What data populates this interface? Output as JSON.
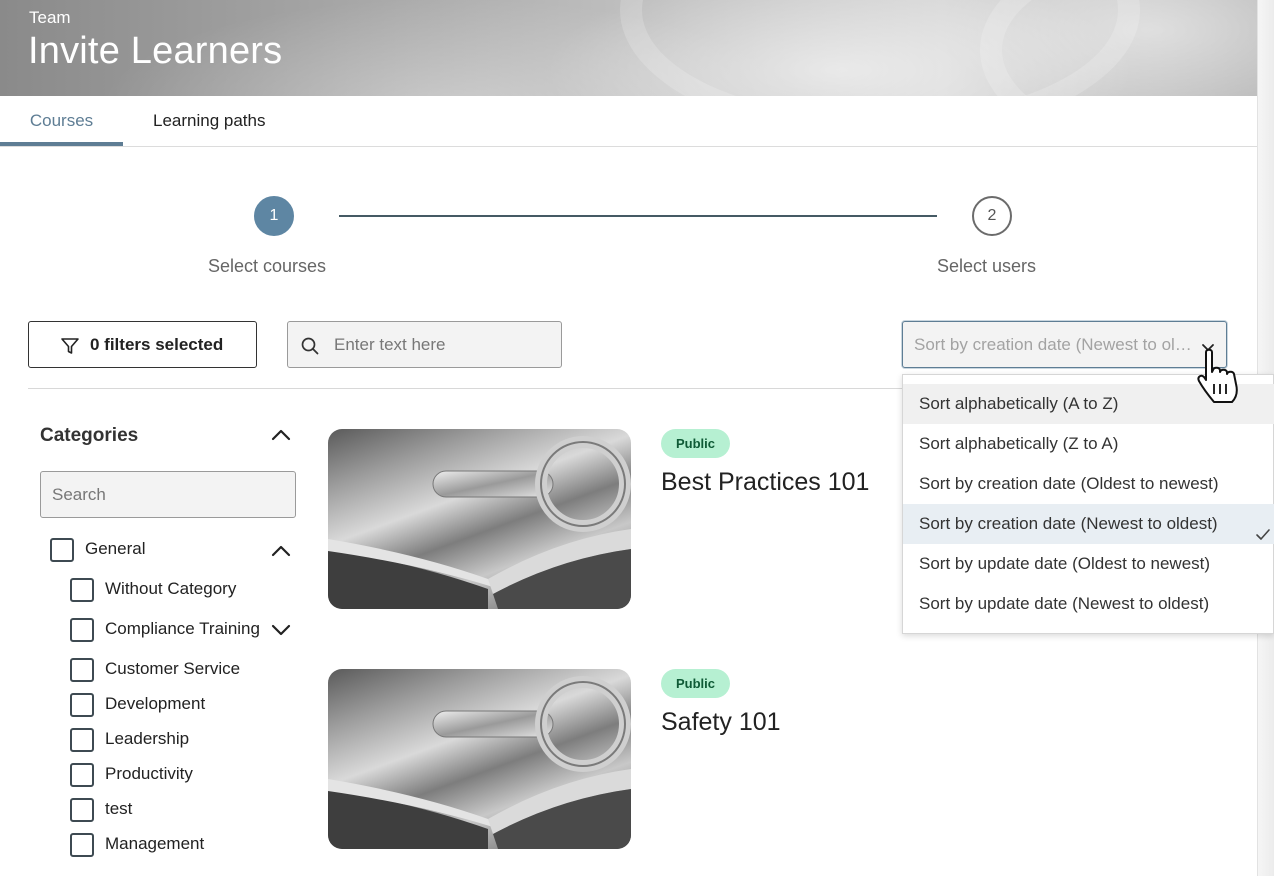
{
  "header": {
    "subtitle": "Team",
    "title": "Invite Learners"
  },
  "tabs": [
    {
      "label": "Courses",
      "active": true
    },
    {
      "label": "Learning paths",
      "active": false
    }
  ],
  "stepper": {
    "steps": [
      {
        "number": "1",
        "label": "Select courses",
        "state": "active"
      },
      {
        "number": "2",
        "label": "Select users",
        "state": "pending"
      }
    ]
  },
  "toolbar": {
    "filter_label": "0 filters selected",
    "search_placeholder": "Enter text here",
    "search_value": "",
    "sort_selected": "Sort by creation date (Newest to oldest)"
  },
  "sort_menu": {
    "options": [
      {
        "label": "Sort alphabetically (A to Z)",
        "state": "hover"
      },
      {
        "label": "Sort alphabetically (Z to A)",
        "state": "normal"
      },
      {
        "label": "Sort by creation date (Oldest to newest)",
        "state": "normal"
      },
      {
        "label": "Sort by creation date (Newest to oldest)",
        "state": "selected"
      },
      {
        "label": "Sort by update date (Oldest to newest)",
        "state": "normal"
      },
      {
        "label": "Sort by update date (Newest to oldest)",
        "state": "normal"
      }
    ]
  },
  "categories": {
    "title": "Categories",
    "search_placeholder": "Search",
    "parent": {
      "label": "General",
      "expanded": true
    },
    "items": [
      {
        "label": "Without Category",
        "checked": false
      },
      {
        "label": "Compliance Training",
        "checked": false,
        "has_children": true,
        "expanded": false
      },
      {
        "label": "Customer Service",
        "checked": false
      },
      {
        "label": "Development",
        "checked": false
      },
      {
        "label": "Leadership",
        "checked": false
      },
      {
        "label": "Productivity",
        "checked": false
      },
      {
        "label": "test",
        "checked": false
      },
      {
        "label": "Management",
        "checked": false
      }
    ]
  },
  "courses": [
    {
      "title": "Best Practices 101",
      "badge": "Public"
    },
    {
      "title": "Safety 101",
      "badge": "Public"
    }
  ],
  "colors": {
    "accent": "#5e7d94",
    "step_active": "#5e86a3",
    "badge_bg": "#b6f0d2",
    "badge_text": "#0f5a36",
    "selected_row": "#e8eef3"
  }
}
